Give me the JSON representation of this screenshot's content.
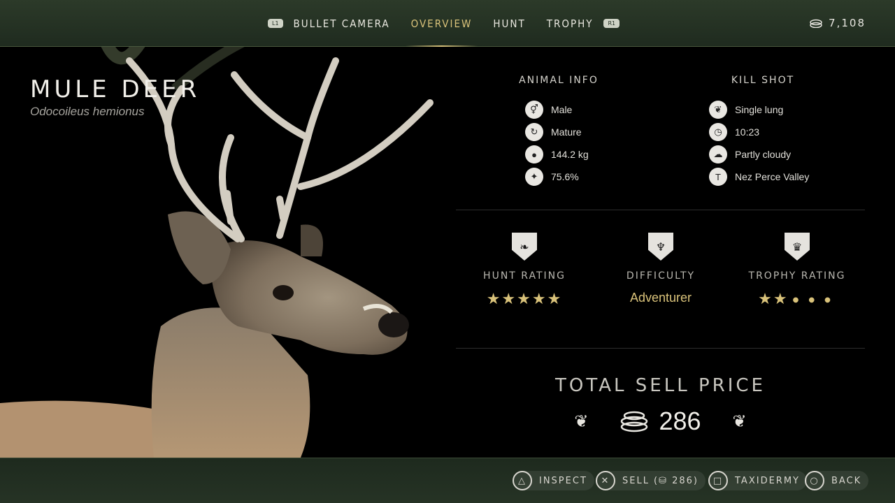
{
  "topbar": {
    "left_button": "L1",
    "right_button": "R1",
    "tabs": [
      {
        "label": "BULLET CAMERA"
      },
      {
        "label": "OVERVIEW"
      },
      {
        "label": "HUNT"
      },
      {
        "label": "TROPHY"
      }
    ],
    "active_tab": "OVERVIEW",
    "currency_value": "7,108"
  },
  "animal": {
    "name": "MULE DEER",
    "scientific_name": "Odocoileus hemionus"
  },
  "animal_info": {
    "title": "ANIMAL INFO",
    "rows": [
      {
        "icon": "gender-icon",
        "text": "Male"
      },
      {
        "icon": "age-icon",
        "text": "Mature"
      },
      {
        "icon": "weight-icon",
        "text": "144.2 kg"
      },
      {
        "icon": "integrity-icon",
        "text": "75.6%"
      }
    ]
  },
  "kill_shot": {
    "title": "KILL SHOT",
    "rows": [
      {
        "icon": "lung-icon",
        "text": "Single lung"
      },
      {
        "icon": "clock-icon",
        "text": "10:23"
      },
      {
        "icon": "weather-icon",
        "text": "Partly cloudy"
      },
      {
        "icon": "location-icon",
        "text": "Nez Perce Valley"
      }
    ]
  },
  "ratings": {
    "hunt": {
      "label": "HUNT RATING",
      "stars": 5,
      "max": 5
    },
    "difficulty": {
      "label": "DIFFICULTY",
      "value": "Adventurer"
    },
    "trophy": {
      "label": "TROPHY RATING",
      "stars": 2,
      "max": 5
    }
  },
  "sell": {
    "title": "TOTAL SELL PRICE",
    "value": "286"
  },
  "actions": [
    {
      "button": "triangle",
      "label": "INSPECT"
    },
    {
      "button": "cross",
      "label": "SELL",
      "price": "286"
    },
    {
      "button": "square",
      "label": "TAXIDERMY"
    },
    {
      "button": "circle",
      "label": "BACK"
    }
  ],
  "colors": {
    "accent_gold": "#d9c27a",
    "bar_green": "#263325"
  }
}
